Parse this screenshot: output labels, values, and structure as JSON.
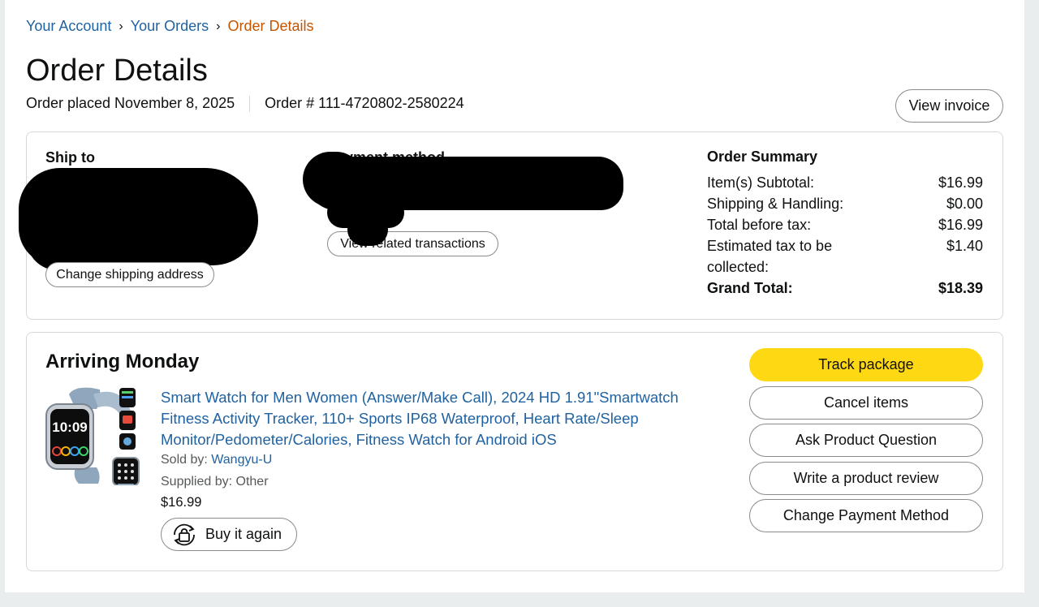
{
  "breadcrumb": {
    "your_account": "Your Account",
    "separator": "›",
    "your_orders": "Your Orders",
    "current": "Order Details"
  },
  "page_title": "Order Details",
  "order_meta": {
    "placed": "Order placed November 8, 2025",
    "order_number": "Order # 111-4720802-2580224"
  },
  "invoice_button": "View invoice",
  "ship_to": {
    "label": "Ship to",
    "change_button": "Change shipping address"
  },
  "payment": {
    "label": "Payment method",
    "visible_label_fragment": "yment method",
    "related_button": "View related transactions"
  },
  "order_summary": {
    "title": "Order Summary",
    "rows": [
      {
        "label": "Item(s) Subtotal:",
        "value": "$16.99"
      },
      {
        "label": "Shipping & Handling:",
        "value": "$0.00"
      },
      {
        "label": "Total before tax:",
        "value": "$16.99"
      },
      {
        "label": "Estimated tax to be collected:",
        "value": "$1.40"
      }
    ],
    "grand_total": {
      "label": "Grand Total:",
      "value": "$18.39"
    }
  },
  "shipment": {
    "heading": "Arriving Monday",
    "product": {
      "title": "Smart Watch for Men Women (Answer/Make Call), 2024 HD 1.91\"Smartwatch Fitness Activity Tracker, 110+ Sports IP68 Waterproof, Heart Rate/Sleep Monitor/Pedometer/Calories, Fitness Watch for Android iOS",
      "sold_by_label": "Sold by: ",
      "seller": "Wangyu-U",
      "supplied_by": "Supplied by: Other",
      "price": "$16.99",
      "watch_time": "10:09",
      "buy_again": "Buy it again"
    },
    "actions": [
      "Track package",
      "Cancel items",
      "Ask Product Question",
      "Write a product review",
      "Change Payment Method"
    ]
  },
  "colors": {
    "link": "#2162a1",
    "breadcrumb_current": "#c45500",
    "primary_button": "#ffd814",
    "border": "#d5d9d9",
    "background": "#eaeded"
  }
}
